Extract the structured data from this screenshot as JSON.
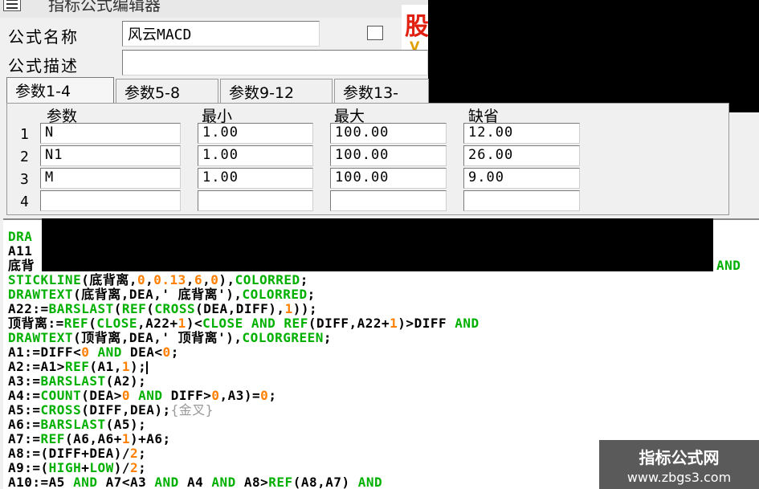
{
  "window": {
    "title": "指标公式编辑器"
  },
  "form": {
    "name_label": "公式名称",
    "name_value": "风云MACD",
    "desc_label": "公式描述",
    "desc_value": ""
  },
  "tabs": [
    {
      "label": "参数1-4"
    },
    {
      "label": "参数5-8"
    },
    {
      "label": "参数9-12"
    },
    {
      "label": "参数13-"
    }
  ],
  "param_table": {
    "headers": [
      "参数",
      "最小",
      "最大",
      "缺省"
    ],
    "rows": [
      {
        "num": "1",
        "name": "N",
        "min": "1.00",
        "max": "100.00",
        "def": "12.00"
      },
      {
        "num": "2",
        "name": "N1",
        "min": "1.00",
        "max": "100.00",
        "def": "26.00"
      },
      {
        "num": "3",
        "name": "M",
        "min": "1.00",
        "max": "100.00",
        "def": "9.00"
      },
      {
        "num": "4",
        "name": "",
        "min": "",
        "max": "",
        "def": ""
      }
    ]
  },
  "code": {
    "l0": "DRA",
    "l1": "A11",
    "l2a": "底背",
    "l2b": "AND",
    "l3a": "STICKLINE",
    "l3b": "(底背离,",
    "l3c": "0",
    "l3d": ",",
    "l3e": "0.13",
    "l3f": ",",
    "l3g": "6",
    "l3h": ",",
    "l3i": "0",
    "l3j": "),",
    "l3k": "COLORRED",
    "l3l": ";",
    "l4a": "DRAWTEXT",
    "l4b": "(底背离,DEA,' 底背离'),",
    "l4c": "COLORRED",
    "l4d": ";",
    "l5a": "A22:=",
    "l5b": "BARSLAST",
    "l5c": "(",
    "l5d": "REF",
    "l5e": "(",
    "l5f": "CROSS",
    "l5g": "(DEA,DIFF),",
    "l5h": "1",
    "l5i": "));",
    "l6a": "顶背离:=",
    "l6b": "REF",
    "l6c": "(",
    "l6d": "CLOSE",
    "l6e": ",A22+",
    "l6f": "1",
    "l6g": ")<",
    "l6h": "CLOSE",
    "l6i": " AND ",
    "l6j": "REF",
    "l6k": "(DIFF,A22+",
    "l6l": "1",
    "l6m": ")>DIFF ",
    "l6n": "AND",
    "l7a": "DRAWTEXT",
    "l7b": "(顶背离,DEA,' 顶背离'),",
    "l7c": "COLORGREEN",
    "l7d": ";",
    "l8a": "A1:=DIFF<",
    "l8b": "0",
    "l8c": " AND ",
    "l8d": "DEA<",
    "l8e": "0",
    "l8f": ";",
    "l9a": "A2:=A1>",
    "l9b": "REF",
    "l9c": "(A1,",
    "l9d": "1",
    "l9e": ");",
    "l10a": "A3:=",
    "l10b": "BARSLAST",
    "l10c": "(A2);",
    "l11a": "A4:=",
    "l11b": "COUNT",
    "l11c": "(DEA>",
    "l11d": "0",
    "l11e": " AND ",
    "l11f": "DIFF>",
    "l11g": "0",
    "l11h": ",A3)=",
    "l11i": "0",
    "l11j": ";",
    "l12a": "A5:=",
    "l12b": "CROSS",
    "l12c": "(DIFF,DEA);",
    "l12d": "{金叉}",
    "l13a": "A6:=",
    "l13b": "BARSLAST",
    "l13c": "(A5);",
    "l14a": "A7:=",
    "l14b": "REF",
    "l14c": "(A6,A6+",
    "l14d": "1",
    "l14e": ")+A6;",
    "l15a": "A8:=(DIFF+DEA)/",
    "l15b": "2",
    "l15c": ";",
    "l16a": "A9:=(",
    "l16b": "HIGH",
    "l16c": "+",
    "l16d": "LOW",
    "l16e": ")/",
    "l16f": "2",
    "l16g": ";",
    "l17a": "A10:=A5 ",
    "l17b": "AND",
    "l17c": " A7<A3 ",
    "l17d": "AND",
    "l17e": " A4 ",
    "l17f": "AND",
    "l17g": " A8>",
    "l17h": "REF",
    "l17i": "(A8,A7) ",
    "l17j": "AND"
  },
  "logo": {
    "char": "股",
    "sub": "V"
  },
  "watermark": {
    "line1": "指标公式网",
    "line2": "www.zbgs3.com"
  },
  "colors": {
    "keyword_green": "#00b000",
    "number_orange": "#ff8000",
    "watermark_bg": "#5a5a5a"
  }
}
